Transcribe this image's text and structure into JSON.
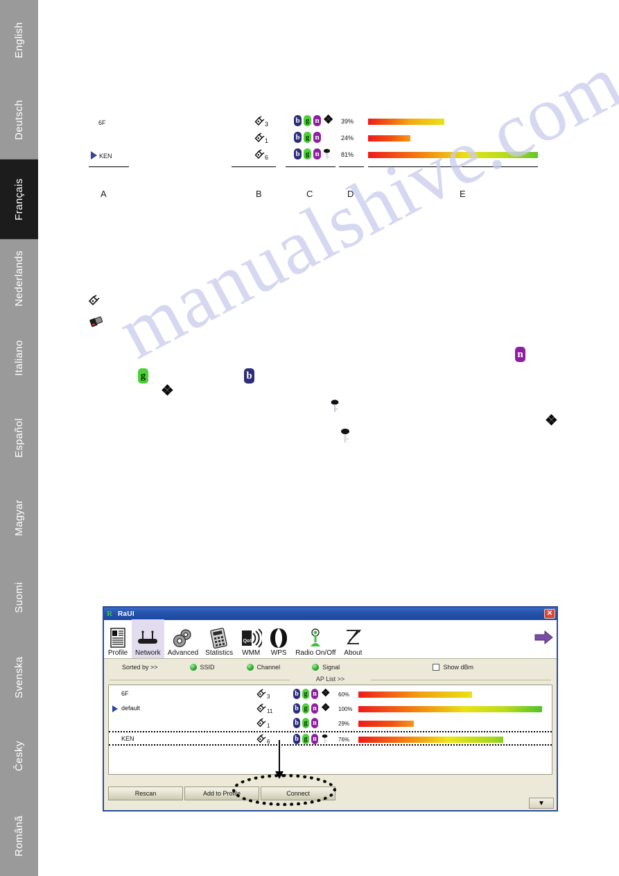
{
  "sidebar": {
    "items": [
      {
        "label": "English",
        "active": false
      },
      {
        "label": "Deutsch",
        "active": false
      },
      {
        "label": "Français",
        "active": true
      },
      {
        "label": "Nederlands",
        "active": false
      },
      {
        "label": "Italiano",
        "active": false
      },
      {
        "label": "Español",
        "active": false
      },
      {
        "label": "Magyar",
        "active": false
      },
      {
        "label": "Suomi",
        "active": false
      },
      {
        "label": "Svenska",
        "active": false
      },
      {
        "label": "Česky",
        "active": false
      },
      {
        "label": "Română",
        "active": false
      }
    ]
  },
  "diagram": {
    "column_letters": [
      "A",
      "B",
      "C",
      "D",
      "E"
    ],
    "ssid_top": "6F",
    "ssid_selected": "KEN",
    "rows": [
      {
        "channel": "3",
        "modes": [
          "b",
          "g",
          "n"
        ],
        "extra": "wps",
        "signal": "39%",
        "bar_pct": 45
      },
      {
        "channel": "1",
        "modes": [
          "b",
          "g",
          "n"
        ],
        "extra": "",
        "signal": "24%",
        "bar_pct": 25
      },
      {
        "channel": "6",
        "modes": [
          "b",
          "g",
          "n"
        ],
        "extra": "key",
        "signal": "81%",
        "bar_pct": 100
      }
    ]
  },
  "legend_icons": {
    "antenna": "antenna-icon",
    "adapter": "usb-adapter-icon",
    "mode_g": "g",
    "mode_b": "b",
    "mode_n": "n",
    "wps": "wps-icon",
    "key": "key-icon"
  },
  "watermark": {
    "text": "manualshive.com"
  },
  "raui": {
    "title": "RaUI",
    "logo": "R",
    "close_label": "✕",
    "toolbar": [
      {
        "label": "Profile",
        "icon": "profile-icon",
        "selected": false
      },
      {
        "label": "Network",
        "icon": "router-icon",
        "selected": true
      },
      {
        "label": "Advanced",
        "icon": "gears-icon",
        "selected": false
      },
      {
        "label": "Statistics",
        "icon": "calc-icon",
        "selected": false
      },
      {
        "label": "WMM",
        "icon": "qos-icon",
        "selected": false
      },
      {
        "label": "WPS",
        "icon": "wps-icon",
        "selected": false
      },
      {
        "label": "Radio On/Off",
        "icon": "radio-icon",
        "selected": false
      },
      {
        "label": "About",
        "icon": "about-icon",
        "selected": false
      }
    ],
    "next_arrow": "next-arrow-icon",
    "sortbar": {
      "sorted_by": "Sorted by >>",
      "options": [
        "SSID",
        "Channel",
        "Signal"
      ],
      "show_dbm": "Show dBm",
      "show_dbm_checked": false
    },
    "aplist_divider": "AP List >>",
    "ap_rows": [
      {
        "ssid": "6F",
        "channel": "3",
        "modes": [
          "b",
          "g",
          "n"
        ],
        "extra": "wps",
        "signal": "60%",
        "bar_pct": 62,
        "selected": false,
        "current": false
      },
      {
        "ssid": "default",
        "channel": "11",
        "modes": [
          "b",
          "g",
          "n"
        ],
        "extra": "wps",
        "signal": "100%",
        "bar_pct": 100,
        "selected": false,
        "current": true
      },
      {
        "ssid": "",
        "channel": "1",
        "modes": [
          "b",
          "g",
          "n"
        ],
        "extra": "",
        "signal": "29%",
        "bar_pct": 30,
        "selected": false,
        "current": false
      },
      {
        "ssid": "KEN",
        "channel": "6",
        "modes": [
          "b",
          "g",
          "n"
        ],
        "extra": "key",
        "signal": "76%",
        "bar_pct": 79,
        "selected": true,
        "current": false
      }
    ],
    "buttons": [
      {
        "label": "Rescan"
      },
      {
        "label": "Add to Profile"
      },
      {
        "label": "Connect"
      }
    ],
    "scroll_down": "▼"
  }
}
